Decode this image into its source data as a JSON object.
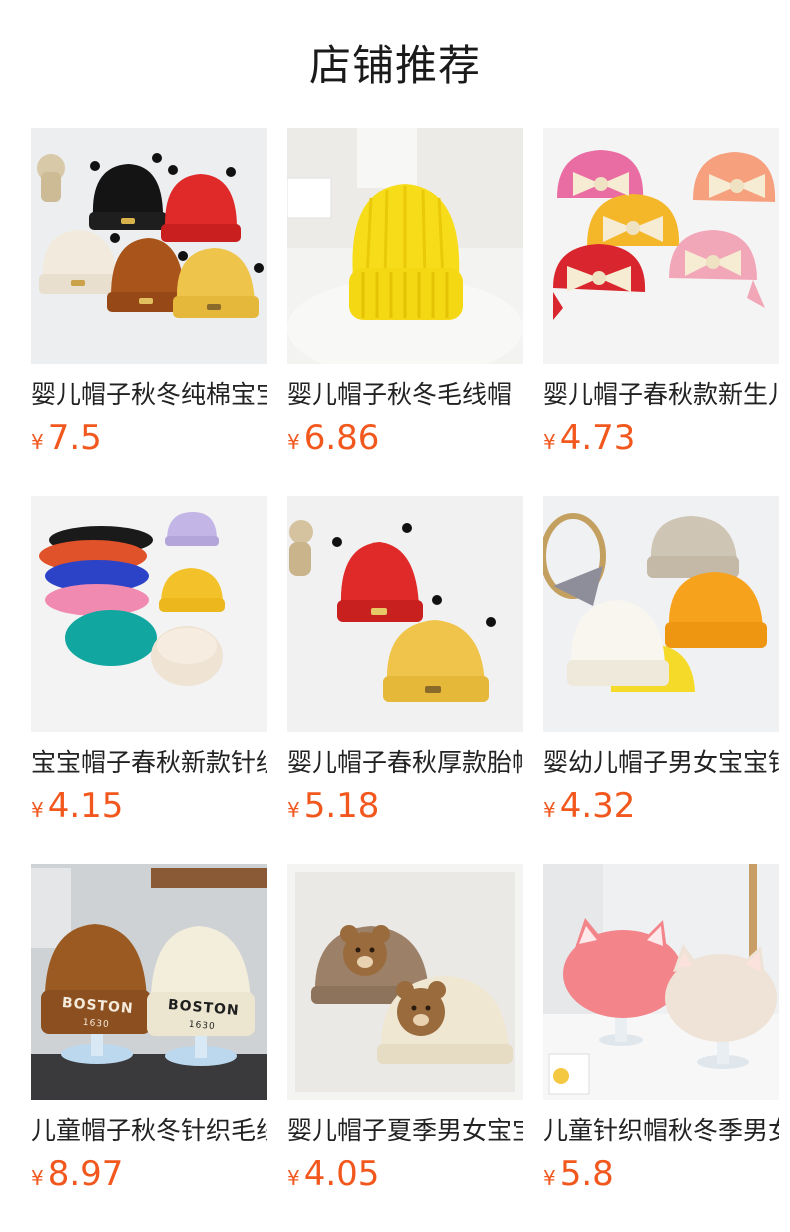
{
  "header": {
    "title": "店铺推荐"
  },
  "currency_symbol": "¥",
  "accent_color": "#f2581d",
  "products": [
    {
      "name": "婴儿帽子秋冬纯棉宝宝",
      "price": "7.5"
    },
    {
      "name": "婴儿帽子秋冬毛线帽",
      "price": "6.86"
    },
    {
      "name": "婴儿帽子春秋款新生儿",
      "price": "4.73"
    },
    {
      "name": "宝宝帽子春秋新款针织",
      "price": "4.15"
    },
    {
      "name": "婴儿帽子春秋厚款胎帽",
      "price": "5.18"
    },
    {
      "name": "婴幼儿帽子男女宝宝针",
      "price": "4.32"
    },
    {
      "name": "儿童帽子秋冬针织毛线",
      "price": "8.97"
    },
    {
      "name": "婴儿帽子夏季男女宝宝",
      "price": "4.05"
    },
    {
      "name": "儿童针织帽秋冬季男女",
      "price": "5.8"
    }
  ],
  "images": {
    "p0": "hats-black-red-white-brown-yellow-with-antennae",
    "p1": "yellow-knit-beanie",
    "p2": "turban-hats-with-bows",
    "p3": "colorful-berets",
    "p4": "red-and-yellow-antenna-hats",
    "p5": "beige-white-orange-beanies",
    "p6": "boston-knit-beanies-on-stands",
    "p7": "bear-turban-hats",
    "p8": "cat-ear-berets"
  }
}
